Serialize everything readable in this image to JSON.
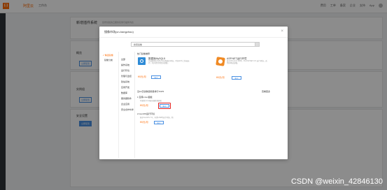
{
  "topbar": {
    "logo": "(-)",
    "logo_text": "阿里云",
    "workspace": "工作台",
    "links": [
      "费用",
      "工单",
      "备案",
      "企业",
      "支持",
      "App"
    ]
  },
  "page": {
    "header_title": "新增插件系统",
    "header_sub": "您所创建的云服务实例与插件列表",
    "section_left_1": "概览",
    "section_left_2": "实例组",
    "section_left_3": "安全设置",
    "side_btn_1": "立即配置",
    "side_btn_2": "立即配置",
    "side_btn_3": "立即配置"
  },
  "modal": {
    "title": "镜像市场(cn-hangzhou)",
    "close": "×",
    "search_value": "搜索镜像",
    "categories": [
      {
        "label": "✓ 精选镜像",
        "active": true
      },
      {
        "label": "镜像分类",
        "active": false
      }
    ],
    "sub_categories": [
      "全部",
      "操作系统",
      "运行环境",
      "管理与监控",
      "建站系统",
      "应用开发",
      "数据库",
      "服务器软件",
      "企业应用",
      "安全合作伙伴"
    ],
    "recommend_title": "热门镜像推荐",
    "recommend": [
      {
        "name": "数据库MySQL5",
        "desc": "完成配置好的MySQL数据库环境，可在ECS上快速运行，已内置常用优化参数。",
        "price": "¥0元/月",
        "buy": "购买"
      },
      {
        "name": "ASP.NET运行环境",
        "desc": "基于Windows 2008，IIS ASP.NET 4.5 运行环境，适用于网站部署。",
        "price": "¥0元/月",
        "buy": "购买"
      }
    ],
    "rank_title": "近10日镜像使用量排行TOP5",
    "rank_more": "查看更多",
    "rank": [
      {
        "title": "1.宝塔Linux面板",
        "desc": "可视化Linux服务器管理面板",
        "price": "¥0元/月",
        "buy": "购买"
      },
      {
        "title": "2.CentOS运行环境",
        "desc": "基于CentOS 7.6，内置LNMP运行环境，简",
        "price": "¥0元/月",
        "buy": "购买"
      }
    ]
  },
  "watermark": "CSDN @weixin_42846130"
}
